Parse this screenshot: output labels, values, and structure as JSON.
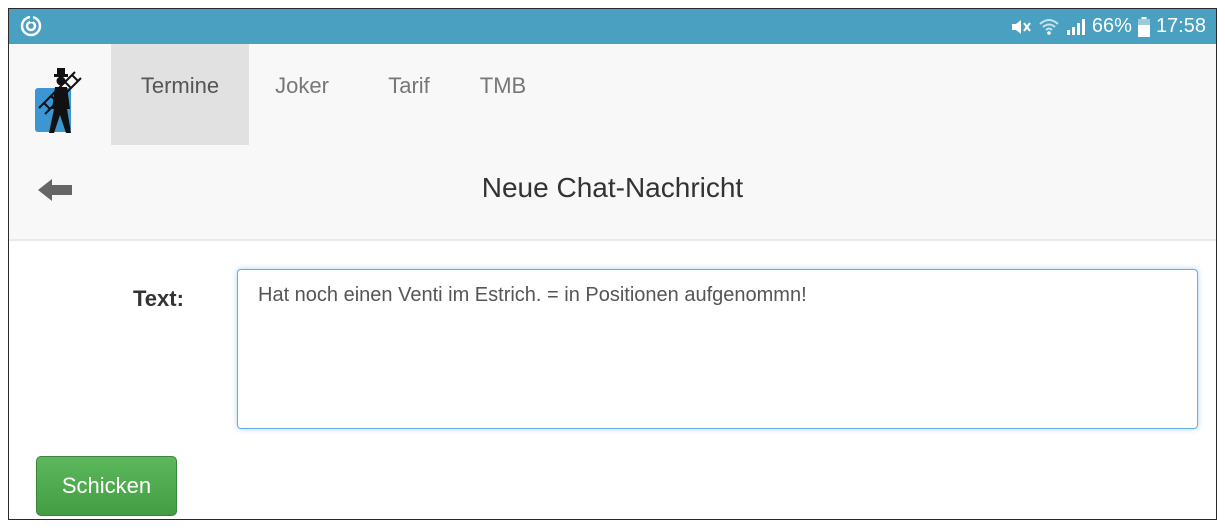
{
  "statusbar": {
    "battery_percent": "66%",
    "time": "17:58",
    "icons": [
      "app-notification-icon",
      "mute-icon",
      "wifi-icon",
      "signal-icon",
      "battery-icon"
    ]
  },
  "nav": {
    "tabs": [
      {
        "label": "Termine",
        "active": true
      },
      {
        "label": "Joker",
        "active": false
      },
      {
        "label": "Tarif",
        "active": false
      },
      {
        "label": "TMB",
        "active": false
      }
    ]
  },
  "page": {
    "title": "Neue Chat-Nachricht"
  },
  "form": {
    "text_label": "Text:",
    "text_value": "Hat noch einen Venti im Estrich. = in Positionen aufgenommn!",
    "send_label": "Schicken"
  },
  "colors": {
    "statusbar": "#4aa0c0",
    "nav_background": "#f8f8f8",
    "active_tab": "#e1e1e1",
    "focus_border": "#66afe9",
    "button_green": "#5cb85c"
  }
}
